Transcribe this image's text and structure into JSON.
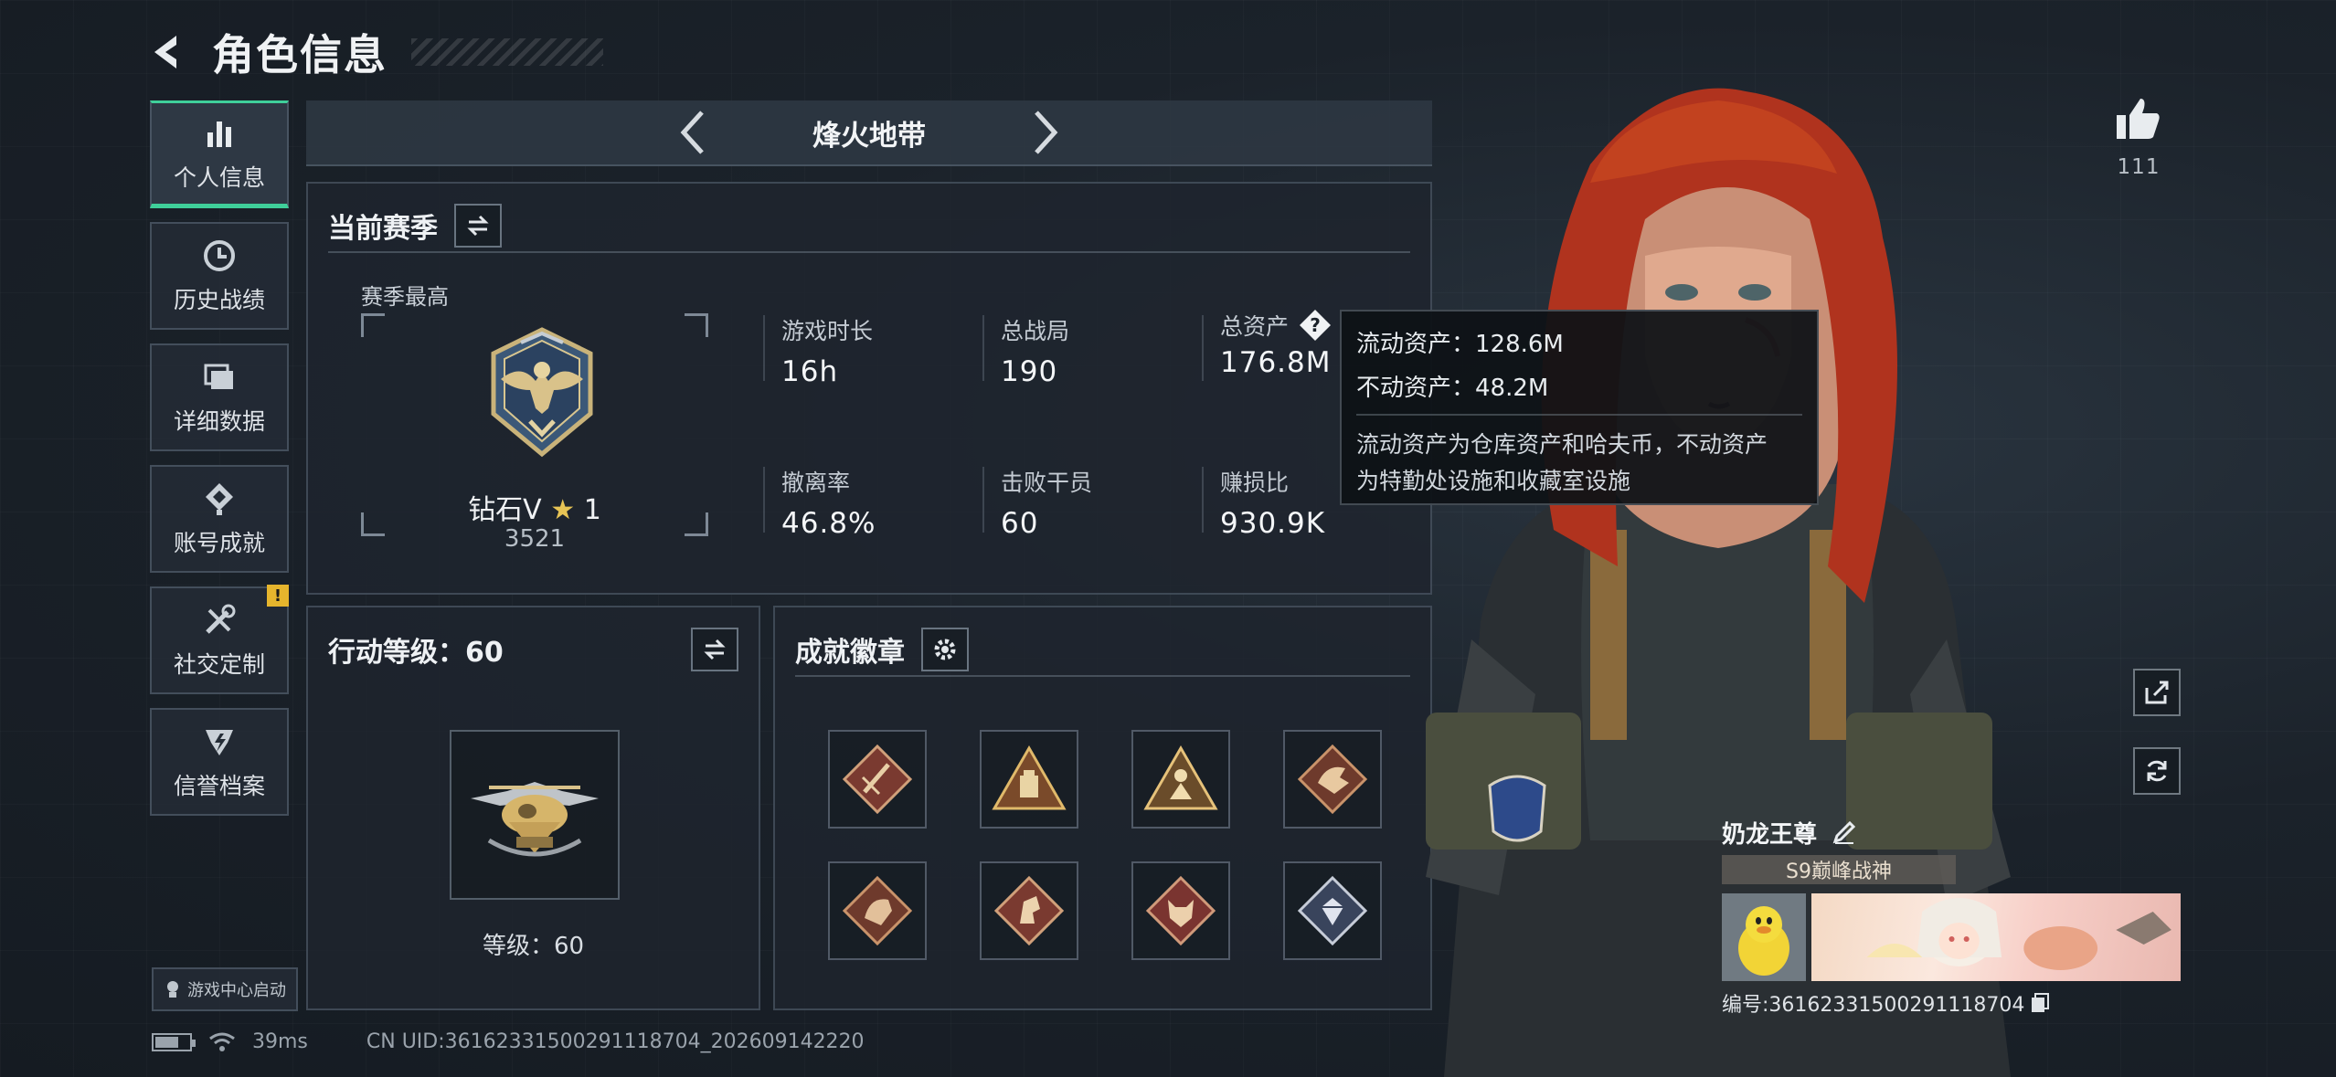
{
  "header": {
    "title": "角色信息"
  },
  "nav": {
    "items": [
      {
        "label": "个人信息",
        "icon": "bar-chart-icon",
        "active": true
      },
      {
        "label": "历史战绩",
        "icon": "history-clock-icon"
      },
      {
        "label": "详细数据",
        "icon": "folder-stack-icon"
      },
      {
        "label": "账号成就",
        "icon": "achievement-icon"
      },
      {
        "label": "社交定制",
        "icon": "tools-icon",
        "badge": "!"
      },
      {
        "label": "信誉档案",
        "icon": "reputation-icon"
      }
    ],
    "game_center": "游戏中心启动"
  },
  "mode": {
    "title": "烽火地带"
  },
  "season": {
    "title": "当前赛季",
    "best_label": "赛季最高",
    "rank_name": "钻石V",
    "rank_star": "★",
    "rank_stars": "1",
    "rank_score": "3521",
    "stats": [
      {
        "label": "游戏时长",
        "value": "16h"
      },
      {
        "label": "总战局",
        "value": "190"
      },
      {
        "label": "总资产",
        "value": "176.8M"
      },
      {
        "label": "撤离率",
        "value": "46.8%"
      },
      {
        "label": "击败干员",
        "value": "60"
      },
      {
        "label": "赚损比",
        "value": "930.9K"
      }
    ]
  },
  "tooltip": {
    "liquid": "流动资产：128.6M",
    "fixed": "不动资产：48.2M",
    "desc_line1": "流动资产为仓库资产和哈夫币，不动资产",
    "desc_line2": "为特勤处设施和收藏室设施"
  },
  "level": {
    "title": "行动等级：60",
    "level_text": "等级：60"
  },
  "badges": {
    "title": "成就徽章",
    "items": [
      "dagger-badge-icon",
      "bag-badge-icon",
      "soldier-badge-icon",
      "dragon-badge-icon",
      "dragon-head-badge-icon",
      "horse-badge-icon",
      "wolf-badge-icon",
      "gem-badge-icon"
    ]
  },
  "likes": {
    "count": "111"
  },
  "player": {
    "name": "奶龙王尊",
    "title": "S9巅峰战神",
    "id": "编号:3616233150029111870​4"
  },
  "footer": {
    "ping": "39ms",
    "uid": "CN UID:3616233150029111870​4_202609142220",
    "battery_level": 0.7
  },
  "colors": {
    "accent": "#3fcf9a",
    "warning": "#e6b52d",
    "star": "#e7c455"
  }
}
